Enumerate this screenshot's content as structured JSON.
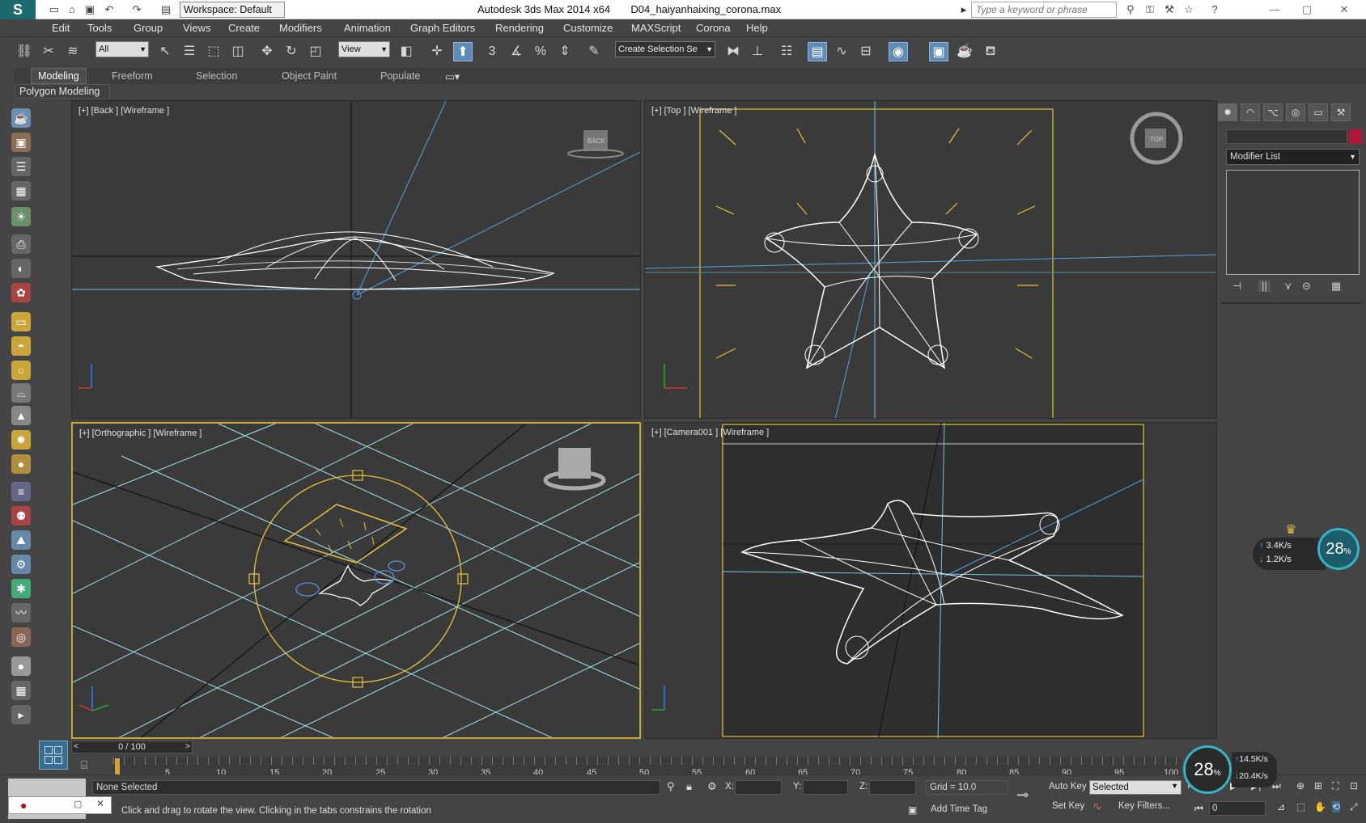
{
  "titlebar": {
    "workspace": "Workspace: Default",
    "app": "Autodesk 3ds Max  2014 x64",
    "file": "D04_haiyanhaixing_corona.max",
    "search_placeholder": "Type a keyword or phrase"
  },
  "menu": [
    "Edit",
    "Tools",
    "Group",
    "Views",
    "Create",
    "Modifiers",
    "Animation",
    "Graph Editors",
    "Rendering",
    "Customize",
    "MAXScript",
    "Corona",
    "Help"
  ],
  "toolbar": {
    "filter": "All",
    "ref_coord": "View",
    "selection_set": "Create Selection Se",
    "snap_labels": [
      "3",
      "%"
    ]
  },
  "ribbon": {
    "tabs": [
      "Modeling",
      "Freeform",
      "Selection",
      "Object Paint",
      "Populate"
    ],
    "active": "Modeling",
    "panel": "Polygon Modeling"
  },
  "viewports": [
    {
      "label": "[+] [Back ] [Wireframe ]",
      "cube": "BACK"
    },
    {
      "label": "[+] [Top ] [Wireframe ]",
      "cube": "TOP"
    },
    {
      "label": "[+] [Orthographic ] [Wireframe ]"
    },
    {
      "label": "[+] [Camera001 ] [Wireframe ]"
    }
  ],
  "command_panel": {
    "modifier_list": "Modifier List"
  },
  "network": {
    "up": "3.4K/s",
    "down": "1.2K/s",
    "percent": "28",
    "unit": "%"
  },
  "network2": {
    "up": "14.5K/s",
    "down": "20.4K/s",
    "percent": "28"
  },
  "timeline": {
    "frame": "0 / 100",
    "ticks": [
      "5",
      "10",
      "15",
      "20",
      "25",
      "30",
      "35",
      "40",
      "45",
      "50",
      "55",
      "60",
      "65",
      "70",
      "75",
      "80",
      "85",
      "90",
      "95",
      "100"
    ]
  },
  "status": {
    "selection": "None Selected",
    "prompt": "Click and drag to rotate the view.  Clicking in the tabs constrains the rotation",
    "x_label": "X:",
    "y_label": "Y:",
    "z_label": "Z:",
    "grid": "Grid = 10.0",
    "add_time_tag": "Add Time Tag",
    "auto_key": "Auto Key",
    "set_key": "Set Key",
    "key_mode": "Selected",
    "key_filters": "Key Filters...",
    "frame_field": "0"
  },
  "colors": {
    "accent": "#5f8db8",
    "active_border": "#c9a53a",
    "wire": "#ffffff",
    "grid": "#9fe3ee",
    "light": "#e6c23a",
    "camera_line": "#4fa3e0"
  }
}
